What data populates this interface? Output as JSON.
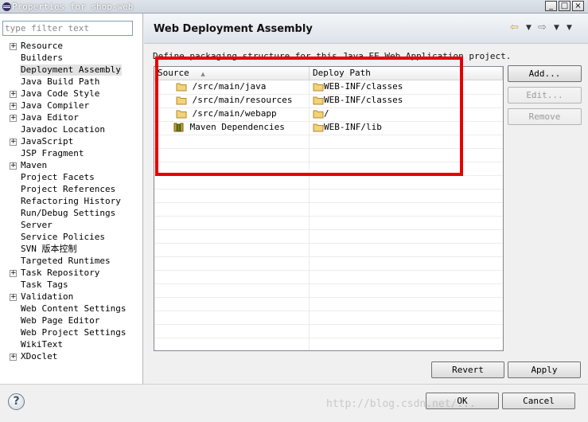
{
  "window": {
    "title": "Properties for shop-web",
    "minimize": "_",
    "maximize": "□",
    "close": "×"
  },
  "filter": {
    "placeholder": "type filter text"
  },
  "tree": [
    {
      "label": "Resource",
      "expandable": true
    },
    {
      "label": "Builders",
      "expandable": false
    },
    {
      "label": "Deployment Assembly",
      "expandable": false,
      "selected": true
    },
    {
      "label": "Java Build Path",
      "expandable": false
    },
    {
      "label": "Java Code Style",
      "expandable": true
    },
    {
      "label": "Java Compiler",
      "expandable": true
    },
    {
      "label": "Java Editor",
      "expandable": true
    },
    {
      "label": "Javadoc Location",
      "expandable": false
    },
    {
      "label": "JavaScript",
      "expandable": true
    },
    {
      "label": "JSP Fragment",
      "expandable": false
    },
    {
      "label": "Maven",
      "expandable": true
    },
    {
      "label": "Project Facets",
      "expandable": false
    },
    {
      "label": "Project References",
      "expandable": false
    },
    {
      "label": "Refactoring History",
      "expandable": false
    },
    {
      "label": "Run/Debug Settings",
      "expandable": false
    },
    {
      "label": "Server",
      "expandable": false
    },
    {
      "label": "Service Policies",
      "expandable": false
    },
    {
      "label": "SVN 版本控制",
      "expandable": false
    },
    {
      "label": "Targeted Runtimes",
      "expandable": false
    },
    {
      "label": "Task Repository",
      "expandable": true
    },
    {
      "label": "Task Tags",
      "expandable": false
    },
    {
      "label": "Validation",
      "expandable": true
    },
    {
      "label": "Web Content Settings",
      "expandable": false
    },
    {
      "label": "Web Page Editor",
      "expandable": false
    },
    {
      "label": "Web Project Settings",
      "expandable": false
    },
    {
      "label": "WikiText",
      "expandable": false
    },
    {
      "label": "XDoclet",
      "expandable": true
    }
  ],
  "page": {
    "title": "Web Deployment Assembly",
    "description": "Define packaging structure for this Java EE Web Application project."
  },
  "table": {
    "columns": [
      "Source",
      "Deploy Path"
    ],
    "sort_indicator": "▲",
    "rows": [
      {
        "source": "/src/main/java",
        "source_icon": "folder-icon",
        "deploy": "WEB-INF/classes"
      },
      {
        "source": "/src/main/resources",
        "source_icon": "folder-icon",
        "deploy": "WEB-INF/classes"
      },
      {
        "source": "/src/main/webapp",
        "source_icon": "folder-icon",
        "deploy": "/"
      },
      {
        "source": "Maven Dependencies",
        "source_icon": "library-icon",
        "deploy": "WEB-INF/lib"
      }
    ],
    "highlight_color": "#e60000"
  },
  "buttons": {
    "add": "Add...",
    "edit": "Edit...",
    "remove": "Remove",
    "revert": "Revert",
    "apply": "Apply",
    "ok": "OK",
    "cancel": "Cancel"
  },
  "help": {
    "glyph": "?"
  },
  "watermark": "http://blog.csdn.net/..."
}
